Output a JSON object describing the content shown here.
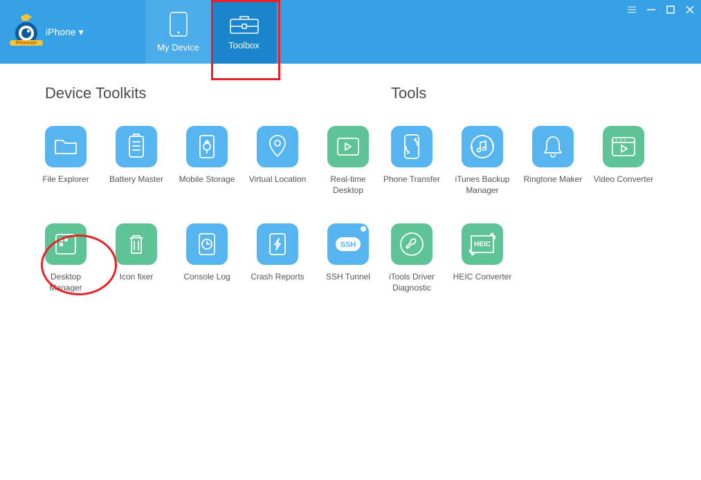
{
  "header": {
    "device_label": "iPhone",
    "premium_badge": "Premium",
    "tabs": {
      "mydevice": "My Device",
      "toolbox": "Toolbox"
    }
  },
  "sections": {
    "toolkits": {
      "title": "Device Toolkits",
      "items": [
        {
          "label": "File Explorer",
          "icon": "folder",
          "color": "blue"
        },
        {
          "label": "Battery Master",
          "icon": "battery",
          "color": "blue"
        },
        {
          "label": "Mobile Storage",
          "icon": "usb",
          "color": "blue"
        },
        {
          "label": "Virtual Location",
          "icon": "location",
          "color": "blue"
        },
        {
          "label": "Real-time Desktop",
          "icon": "play-rect",
          "color": "green"
        },
        {
          "label": "Desktop Manager",
          "icon": "grid",
          "color": "green"
        },
        {
          "label": "Icon fixer",
          "icon": "trash",
          "color": "green"
        },
        {
          "label": "Console Log",
          "icon": "clock-doc",
          "color": "blue"
        },
        {
          "label": "Crash Reports",
          "icon": "bolt-doc",
          "color": "blue"
        },
        {
          "label": "SSH Tunnel",
          "icon": "ssh",
          "color": "blue"
        }
      ]
    },
    "tools": {
      "title": "Tools",
      "items": [
        {
          "label": "Phone Transfer",
          "icon": "phone-sync",
          "color": "blue"
        },
        {
          "label": "iTunes Backup Manager",
          "icon": "music-sync",
          "color": "blue"
        },
        {
          "label": "Ringtone Maker",
          "icon": "bell",
          "color": "blue"
        },
        {
          "label": "Video Converter",
          "icon": "video-play",
          "color": "green"
        },
        {
          "label": "iTools Driver Diagnostic",
          "icon": "wrench",
          "color": "green"
        },
        {
          "label": "HEIC Converter",
          "icon": "heic",
          "color": "green"
        }
      ]
    }
  }
}
